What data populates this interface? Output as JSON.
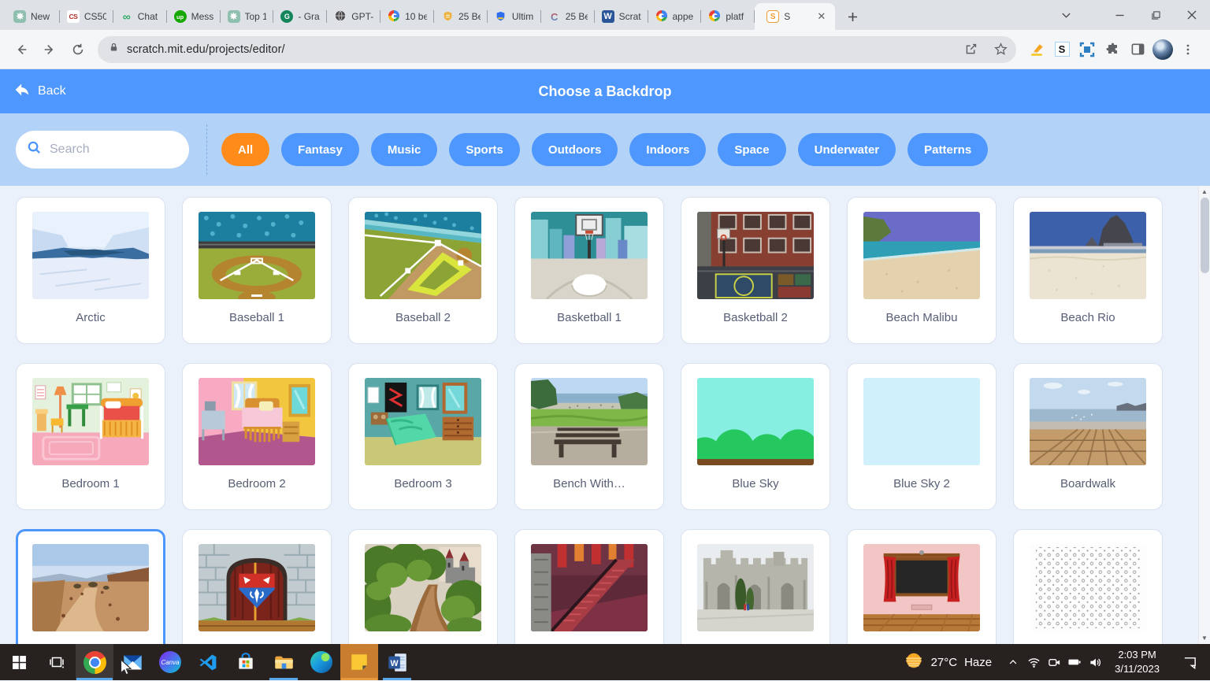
{
  "browser": {
    "tabs": [
      {
        "label": "New",
        "icon": "chatgpt-icon"
      },
      {
        "label": "CS50",
        "icon": "cs50-icon"
      },
      {
        "label": "Chat",
        "icon": "green-infinity-icon"
      },
      {
        "label": "Mess",
        "icon": "upwork-icon"
      },
      {
        "label": "Top 1",
        "icon": "chatgpt-icon"
      },
      {
        "label": "- Gra",
        "icon": "grammarly-icon"
      },
      {
        "label": "GPT-",
        "icon": "globe-icon"
      },
      {
        "label": "10 be",
        "icon": "google-icon"
      },
      {
        "label": "25 Be",
        "icon": "gold-shield-icon"
      },
      {
        "label": "Ultim",
        "icon": "blue-shield-icon"
      },
      {
        "label": "25 Be",
        "icon": "c-logo-icon"
      },
      {
        "label": "Scrat",
        "icon": "word-w-icon"
      },
      {
        "label": "appe",
        "icon": "google-icon"
      },
      {
        "label": "platf",
        "icon": "google-icon"
      },
      {
        "label": "S",
        "icon": "scratch-icon",
        "active": true
      }
    ],
    "address": "scratch.mit.edu/projects/editor/",
    "omnibox_icons": [
      "lock-icon",
      "share-icon",
      "bookmark-star-icon"
    ],
    "extensions": [
      "highlighter-icon",
      "s-badge-icon",
      "screen-capture-icon",
      "puzzle-icon",
      "side-panel-icon",
      "profile-avatar",
      "menu-kebab-icon"
    ],
    "window_controls": [
      "tab-search-chevron",
      "minimize",
      "maximize",
      "close"
    ]
  },
  "modal": {
    "back_label": "Back",
    "title": "Choose a Backdrop",
    "search_placeholder": "Search",
    "filters": [
      {
        "label": "All",
        "active": true
      },
      {
        "label": "Fantasy"
      },
      {
        "label": "Music"
      },
      {
        "label": "Sports"
      },
      {
        "label": "Outdoors"
      },
      {
        "label": "Indoors"
      },
      {
        "label": "Space"
      },
      {
        "label": "Underwater"
      },
      {
        "label": "Patterns"
      }
    ],
    "accent_blue": "#4d97ff",
    "accent_orange": "#ff8c1a"
  },
  "library": {
    "items": [
      {
        "name": "Arctic",
        "image": "arctic"
      },
      {
        "name": "Baseball 1",
        "image": "baseball-1"
      },
      {
        "name": "Baseball 2",
        "image": "baseball-2"
      },
      {
        "name": "Basketball 1",
        "image": "basketball-1"
      },
      {
        "name": "Basketball 2",
        "image": "basketball-2"
      },
      {
        "name": "Beach Malibu",
        "image": "beach-malibu"
      },
      {
        "name": "Beach Rio",
        "image": "beach-rio"
      },
      {
        "name": "Bedroom 1",
        "image": "bedroom-1"
      },
      {
        "name": "Bedroom 2",
        "image": "bedroom-2"
      },
      {
        "name": "Bedroom 3",
        "image": "bedroom-3"
      },
      {
        "name": "Bench With…",
        "image": "bench"
      },
      {
        "name": "Blue Sky",
        "image": "blue-sky"
      },
      {
        "name": "Blue Sky 2",
        "image": "blue-sky-2"
      },
      {
        "name": "Boardwalk",
        "image": "boardwalk"
      },
      {
        "name": "",
        "image": "canyon",
        "selected": true
      },
      {
        "name": "",
        "image": "castle-doors"
      },
      {
        "name": "",
        "image": "forest-castle"
      },
      {
        "name": "",
        "image": "castle-stairs"
      },
      {
        "name": "",
        "image": "castle-stone"
      },
      {
        "name": "",
        "image": "chalkboard"
      },
      {
        "name": "",
        "image": "dot-pattern"
      }
    ]
  },
  "taskbar": {
    "apps": [
      {
        "name": "start"
      },
      {
        "name": "task-view"
      },
      {
        "name": "chrome",
        "indicator": "active"
      },
      {
        "name": "mail"
      },
      {
        "name": "canva"
      },
      {
        "name": "vs-code"
      },
      {
        "name": "microsoft-store"
      },
      {
        "name": "file-explorer",
        "indicator": "open"
      },
      {
        "name": "edge"
      },
      {
        "name": "sticky-notes",
        "indicator": "attention"
      },
      {
        "name": "word",
        "indicator": "open"
      }
    ],
    "weather": {
      "temp": "27°C",
      "condition": "Haze"
    },
    "tray_icons": [
      "hidden-icons-chevron",
      "wifi",
      "meet-now-camera",
      "battery",
      "volume"
    ],
    "clock": {
      "time": "2:03 PM",
      "date": "3/11/2023"
    }
  }
}
